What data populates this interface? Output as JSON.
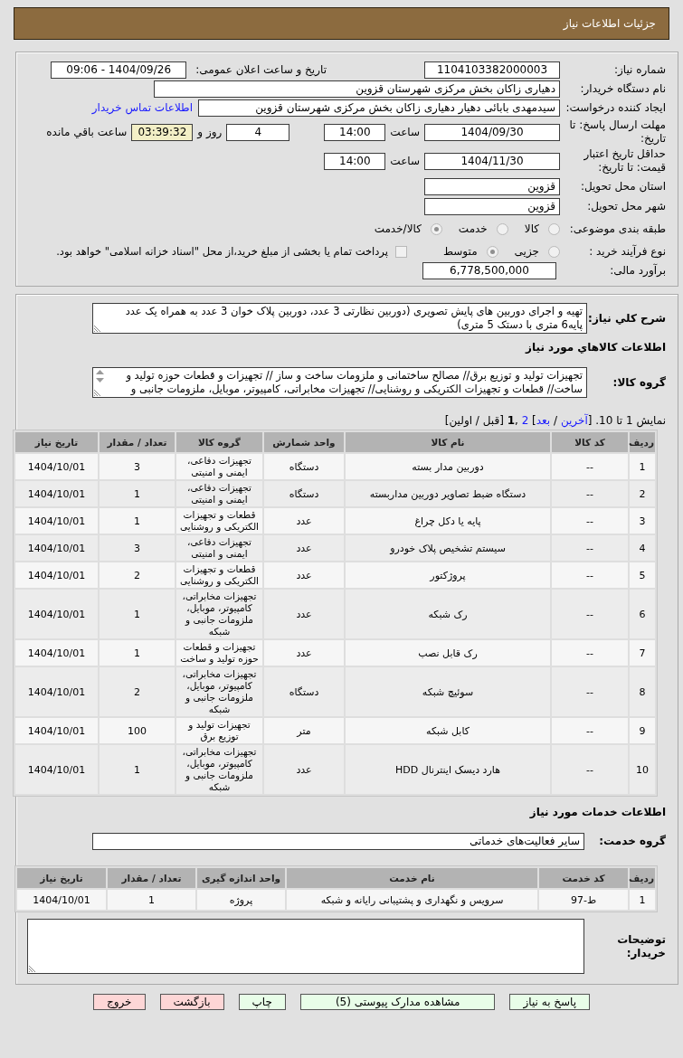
{
  "header": {
    "title": "جزئیات اطلاعات نیاز"
  },
  "details": {
    "need_number": {
      "label": "شماره نیاز:",
      "value": "1104103382000003"
    },
    "announcement": {
      "label": "تاریخ و ساعت اعلان عمومی:",
      "value": "1404/09/26 - 09:06"
    },
    "buyer_org": {
      "label": "نام دستگاه خریدار:",
      "value": "دهیاری زاکان بخش مرکزی شهرستان قزوین"
    },
    "requester": {
      "label": "ایجاد کننده درخواست:",
      "value": "سیدمهدی بابائی دهیار دهیاری زاکان بخش مرکزی شهرستان قزوین",
      "contact_link": "اطلاعات تماس خریدار"
    },
    "response_deadline": {
      "label": "مهلت ارسال پاسخ: تا تاریخ:",
      "date": "1404/09/30",
      "time_label": "ساعت",
      "time": "14:00",
      "days": "4",
      "days_label": "روز و",
      "remaining": "03:39:32",
      "remaining_label": "ساعت باقي مانده"
    },
    "price_validity": {
      "label": "حداقل تاریخ اعتبار قیمت: تا تاریخ:",
      "date": "1404/11/30",
      "time_label": "ساعت",
      "time": "14:00"
    },
    "delivery_province": {
      "label": "استان محل تحویل:",
      "value": "قزوین"
    },
    "delivery_city": {
      "label": "شهر محل تحویل:",
      "value": "قزوین"
    },
    "subject_category": {
      "label": "طبقه بندی موضوعی:",
      "options": [
        {
          "label": "کالا",
          "selected": false
        },
        {
          "label": "خدمت",
          "selected": false
        },
        {
          "label": "کالا/خدمت",
          "selected": true
        }
      ]
    },
    "purchase_process": {
      "label": "نوع فرآیند خرید :",
      "options": [
        {
          "label": "جزیی",
          "selected": false
        },
        {
          "label": "متوسط",
          "selected": true
        }
      ],
      "treasury_bonds": {
        "checked": false,
        "text": "پرداخت تمام یا بخشی از مبلغ خرید،از محل \"اسناد خزانه اسلامی\" خواهد بود."
      }
    },
    "budget": {
      "label": "برآورد مالی:",
      "value": "6,778,500,000"
    }
  },
  "description": {
    "label": "شرح کلي نياز:",
    "value": "تهیه و اجرای دوربین های پایش تصویری (دوربین نظارتی 3 عدد، دوربین پلاک خوان 3 عدد به همراه یک عدد پایه6 متری با دستک 5 متری)"
  },
  "goods": {
    "heading": "اطلاعات کالاهاي مورد نياز",
    "group_label": "گروه کالا:",
    "group_value": "تجهیزات تولید و توزیع برق// مصالح ساختمانی و ملزومات ساخت و ساز // تجهیزات و قطعات حوزه تولید و ساخت// قطعات و تجهیزات الکتریکی و روشنایی// تجهیزات مخابراتی، کامپیوتر، موبایل، ملزومات جانبی و",
    "pager": [
      {
        "kind": "text",
        "text": "نمایش 1 تا 10. ["
      },
      {
        "kind": "link",
        "text": "آخرین"
      },
      {
        "kind": "text",
        "text": " / "
      },
      {
        "kind": "link",
        "text": "بعد"
      },
      {
        "kind": "text",
        "text": "] "
      },
      {
        "kind": "link",
        "text": "2"
      },
      {
        "kind": "text",
        "text": " ,"
      },
      {
        "kind": "current",
        "text": "1"
      },
      {
        "kind": "text",
        "text": " [قبل / اولین]"
      }
    ],
    "table": {
      "columns": [
        "ردیف",
        "کد کالا",
        "نام کالا",
        "واحد شمارش",
        "گروه کالا",
        "تعداد / مقدار",
        "تاریخ نیاز"
      ],
      "rows": [
        {
          "index": "1",
          "code": "--",
          "name": "دوربین مدار بسته",
          "unit": "دستگاه",
          "group": "تجهیزات دفاعی، ایمنی و امنیتی",
          "quantity": "3",
          "date": "1404/10/01"
        },
        {
          "index": "2",
          "code": "--",
          "name": "دستگاه ضبط تصاویر دوربین مداربسته",
          "unit": "دستگاه",
          "group": "تجهیزات دفاعی، ایمنی و امنیتی",
          "quantity": "1",
          "date": "1404/10/01"
        },
        {
          "index": "3",
          "code": "--",
          "name": "پایه یا دکل چراغ",
          "unit": "عدد",
          "group": "قطعات و تجهیزات الکتریکی و روشنایی",
          "quantity": "1",
          "date": "1404/10/01"
        },
        {
          "index": "4",
          "code": "--",
          "name": "سیستم تشخیص پلاک خودرو",
          "unit": "عدد",
          "group": "تجهیزات دفاعی، ایمنی و امنیتی",
          "quantity": "3",
          "date": "1404/10/01"
        },
        {
          "index": "5",
          "code": "--",
          "name": "پروژکتور",
          "unit": "عدد",
          "group": "قطعات و تجهیزات الکتریکی و روشنایی",
          "quantity": "2",
          "date": "1404/10/01"
        },
        {
          "index": "6",
          "code": "--",
          "name": "رک شبکه",
          "unit": "عدد",
          "group": "تجهیزات مخابراتی، کامپیوتر، موبایل، ملزومات جانبی و شبکه",
          "quantity": "1",
          "date": "1404/10/01"
        },
        {
          "index": "7",
          "code": "--",
          "name": "رک قابل نصب",
          "unit": "عدد",
          "group": "تجهیزات و قطعات حوزه تولید و ساخت",
          "quantity": "1",
          "date": "1404/10/01"
        },
        {
          "index": "8",
          "code": "--",
          "name": "سوئیچ شبکه",
          "unit": "دستگاه",
          "group": "تجهیزات مخابراتی، کامپیوتر، موبایل، ملزومات جانبی و شبکه",
          "quantity": "2",
          "date": "1404/10/01"
        },
        {
          "index": "9",
          "code": "--",
          "name": "کابل شبکه",
          "unit": "متر",
          "group": "تجهیزات تولید و توزیع برق",
          "quantity": "100",
          "date": "1404/10/01"
        },
        {
          "index": "10",
          "code": "--",
          "name": "هارد دیسک اینترنال HDD",
          "unit": "عدد",
          "group": "تجهیزات مخابراتی، کامپیوتر، موبایل، ملزومات جانبی و شبکه",
          "quantity": "1",
          "date": "1404/10/01"
        }
      ]
    }
  },
  "services": {
    "heading": "اطلاعات خدمات مورد نیاز",
    "group_label": "گروه خدمت:",
    "group_value": "سایر فعالیت‌های خدماتی",
    "table": {
      "columns": [
        "ردیف",
        "کد خدمت",
        "نام خدمت",
        "واحد اندازه گیری",
        "تعداد / مقدار",
        "تاریخ نیاز"
      ],
      "rows": [
        {
          "index": "1",
          "code": "ط-97",
          "name": "سرویس و نگهداری و پشتیبانی رایانه و شبکه",
          "unit": "پروژه",
          "quantity": "1",
          "date": "1404/10/01"
        }
      ]
    }
  },
  "buyer_notes": {
    "label": "توضیحات خریدار:"
  },
  "buttons": [
    {
      "label": "پاسخ به نیاز",
      "kind": "confirm"
    },
    {
      "label": "مشاهده مدارک پیوستی (5)",
      "kind": "confirm"
    },
    {
      "label": "چاپ",
      "kind": "confirm"
    },
    {
      "label": "بازگشت",
      "kind": "leave"
    },
    {
      "label": "خروج",
      "kind": "leave"
    }
  ]
}
